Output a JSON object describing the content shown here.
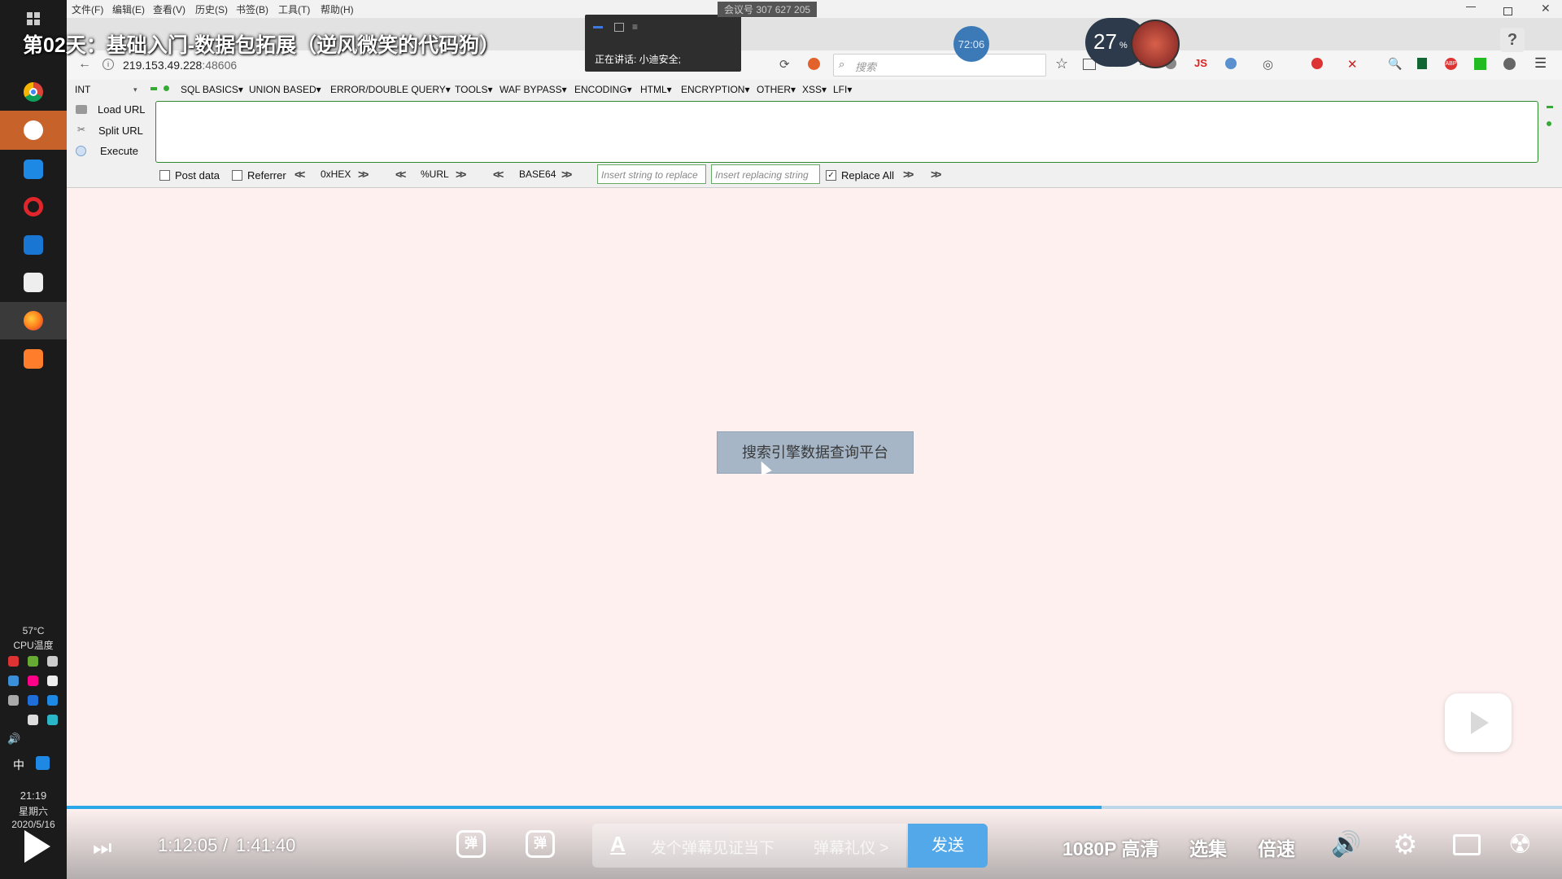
{
  "taskbar": {
    "cpu_temp": "57°C",
    "cpu_label": "CPU温度",
    "ime": "中",
    "clock_time": "21:19",
    "clock_weekday": "星期六",
    "clock_date": "2020/5/16"
  },
  "browser": {
    "menu": [
      "文件(F)",
      "编辑(E)",
      "查看(V)",
      "历史(S)",
      "书签(B)",
      "工具(T)",
      "帮助(H)"
    ],
    "url_host": "219.153.49.228",
    "url_port": ":48606",
    "search_placeholder": "搜索"
  },
  "hackbar": {
    "type_select": "INT",
    "menu": [
      "SQL BASICS▾",
      "UNION BASED▾",
      "ERROR/DOUBLE QUERY▾",
      "TOOLS▾",
      "WAF BYPASS▾",
      "ENCODING▾",
      "HTML▾",
      "ENCRYPTION▾",
      "OTHER▾",
      "XSS▾",
      "LFI▾"
    ],
    "load_url": "Load URL",
    "split_url": "Split URL",
    "execute": "Execute",
    "post_data": "Post data",
    "referrer": "Referrer",
    "hex": "0xHEX",
    "url_enc": "%URL",
    "base64": "BASE64",
    "insert_replace_placeholder": "Insert string to replace",
    "insert_replacing_placeholder": "Insert replacing string",
    "replace_all": "Replace All",
    "replace_all_checked": true
  },
  "overlay": {
    "video_title": "第02天：基础入门-数据包拓展（逆风微笑的代码狗）",
    "speaking": "正在讲话: 小迪安全;",
    "meeting_id": "会议号 307 627 205",
    "timer": "72:06",
    "cpu_percent": "27",
    "cpu_percent_unit": "%",
    "help": "?"
  },
  "page": {
    "button_label": "搜索引擎数据查询平台"
  },
  "player": {
    "current_time": "1:12:05",
    "separator": "/",
    "total_time": "1:41:40",
    "progress": 0.692,
    "danmaku_placeholder": "发个弹幕见证当下",
    "danmaku_etiquette": "弹幕礼仪 >",
    "send": "发送",
    "quality": "1080P 高清",
    "episodes": "选集",
    "speed": "倍速"
  }
}
